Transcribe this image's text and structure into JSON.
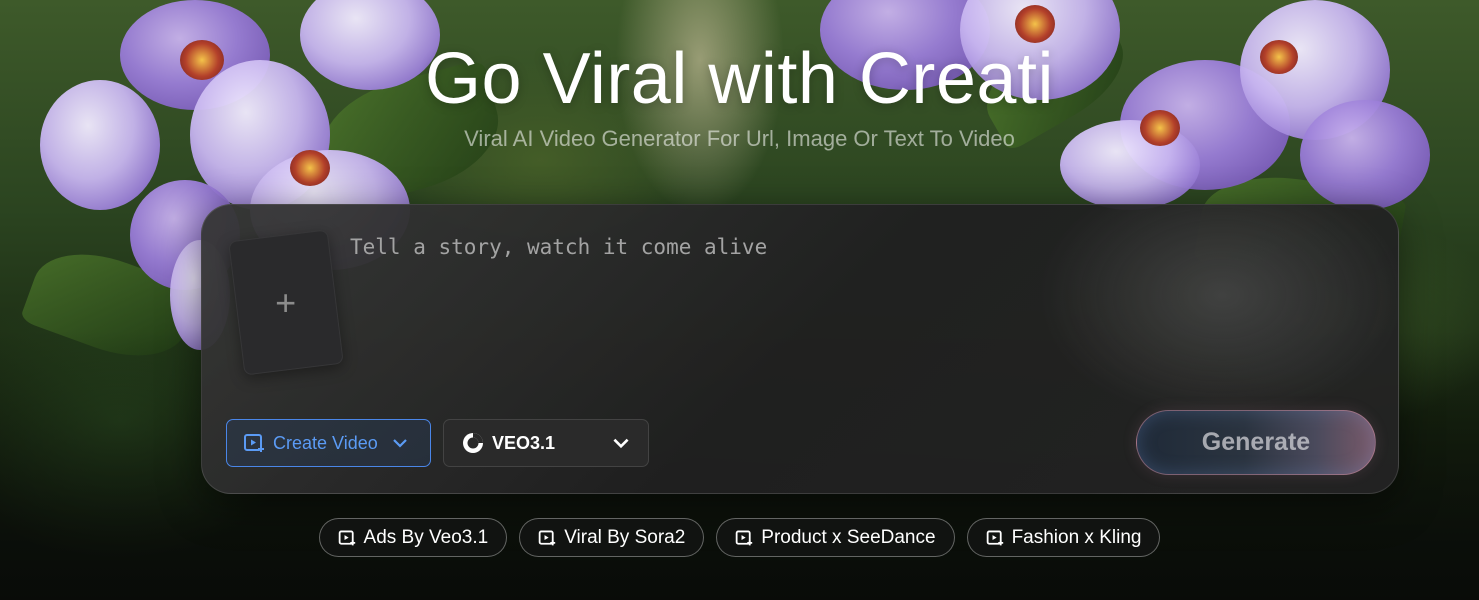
{
  "hero": {
    "title": "Go Viral with Creati",
    "subtitle": "Viral AI Video Generator For Url, Image Or Text To Video"
  },
  "prompt": {
    "placeholder": "Tell a story, watch it come alive",
    "upload_icon": "plus-icon"
  },
  "controls": {
    "mode_label": "Create Video",
    "mode_icon": "video-sparkle-icon",
    "model_label": "VEO3.1",
    "model_icon": "veo-logo-icon",
    "generate_label": "Generate"
  },
  "examples": [
    {
      "label": "Ads By Veo3.1",
      "icon": "video-sparkle-icon"
    },
    {
      "label": "Viral By Sora2",
      "icon": "video-sparkle-icon"
    },
    {
      "label": "Product x SeeDance",
      "icon": "video-sparkle-icon"
    },
    {
      "label": "Fashion x Kling",
      "icon": "video-sparkle-icon"
    }
  ],
  "colors": {
    "accent_blue": "#5b9bf5",
    "card_bg": "#2a2a2a",
    "text_primary": "#ffffff"
  }
}
